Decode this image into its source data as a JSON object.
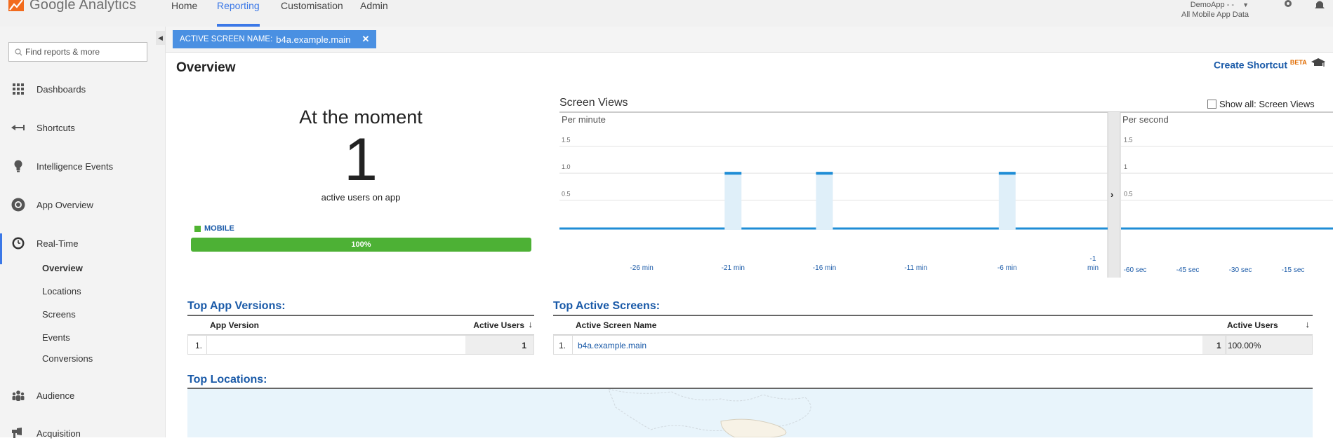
{
  "app": {
    "logo_text": "Google Analytics",
    "nav": [
      "Home",
      "Reporting",
      "Customisation",
      "Admin"
    ],
    "active_nav": "Reporting",
    "account_name": "DemoApp - -",
    "account_view": "All Mobile App Data",
    "brand_color": "#3b78e7"
  },
  "sidebar": {
    "search_placeholder": "Find reports & more",
    "items": [
      {
        "label": "Dashboards",
        "icon": "grid-icon"
      },
      {
        "label": "Shortcuts",
        "icon": "shortcut-arrow-icon"
      },
      {
        "label": "Intelligence Events",
        "icon": "lightbulb-icon"
      },
      {
        "label": "App Overview",
        "icon": "circle-target-icon"
      },
      {
        "label": "Real-Time",
        "icon": "clock-icon"
      },
      {
        "label": "Audience",
        "icon": "people-icon"
      },
      {
        "label": "Acquisition",
        "icon": "acquisition-icon"
      }
    ],
    "realtime_sub": [
      "Overview",
      "Locations",
      "Screens",
      "Events",
      "Conversions"
    ],
    "active_sub": "Overview"
  },
  "filter": {
    "key": "ACTIVE SCREEN NAME:",
    "value": "b4a.example.main",
    "close": "✕"
  },
  "main": {
    "title": "Overview",
    "create_shortcut": "Create Shortcut",
    "beta": "BETA",
    "at_moment": {
      "title": "At the moment",
      "count": "1",
      "subtitle": "active users on app",
      "segment_label": "MOBILE",
      "segment_pct": "100%",
      "segment_fraction": 1.0,
      "segment_color": "#4db135"
    },
    "screen_views": {
      "title": "Screen Views",
      "show_all": "Show all: Screen Views",
      "per_minute": "Per minute",
      "per_second": "Per second"
    },
    "top_app_versions": {
      "title": "Top App Versions:",
      "headers": [
        "App Version",
        "Active Users"
      ],
      "rows": [
        {
          "index": "1.",
          "version": "",
          "users": "1"
        }
      ]
    },
    "top_active_screens": {
      "title": "Top Active Screens:",
      "headers": [
        "Active Screen Name",
        "Active Users"
      ],
      "rows": [
        {
          "index": "1.",
          "name": "b4a.example.main",
          "users": "1",
          "pct": "100.00%"
        }
      ]
    },
    "top_locations": {
      "title": "Top Locations:"
    }
  },
  "chart_data": [
    {
      "type": "bar",
      "title": "Per minute",
      "x": [
        -30,
        -29,
        -28,
        -27,
        -26,
        -25,
        -24,
        -23,
        -22,
        -21,
        -20,
        -19,
        -18,
        -17,
        -16,
        -15,
        -14,
        -13,
        -12,
        -11,
        -10,
        -9,
        -8,
        -7,
        -6,
        -5,
        -4,
        -3,
        -2,
        -1
      ],
      "values": [
        0,
        0,
        0,
        0,
        0,
        0,
        0,
        0,
        0,
        1,
        0,
        0,
        0,
        0,
        1,
        0,
        0,
        0,
        0,
        0,
        0,
        0,
        0,
        0,
        1,
        0,
        0,
        0,
        0,
        0
      ],
      "tick_labels": [
        "-26 min",
        "-21 min",
        "-16 min",
        "-11 min",
        "-6 min",
        "-1 min"
      ],
      "y_ticks": [
        "1.5",
        "1.0",
        "0.5"
      ],
      "ylim": [
        0,
        1.9
      ],
      "grid": true,
      "series_color": "#1f8dd6"
    },
    {
      "type": "bar",
      "title": "Per second",
      "x": [
        -60,
        -45,
        -30,
        -15
      ],
      "values": [
        0,
        0,
        0,
        0
      ],
      "tick_labels": [
        "-60 sec",
        "-45 sec",
        "-30 sec",
        "-15 sec"
      ],
      "y_ticks": [
        "1.5",
        "1",
        "0.5"
      ],
      "ylim": [
        0,
        1.9
      ],
      "grid": true,
      "series_color": "#1f8dd6"
    }
  ]
}
